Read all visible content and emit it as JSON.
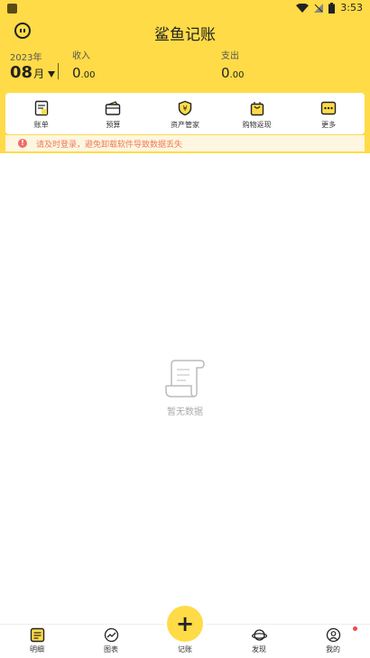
{
  "status": {
    "time": "3:53"
  },
  "header": {
    "title": "鲨鱼记账",
    "year": "2023年",
    "month": "08",
    "month_unit": "月",
    "income": {
      "label": "收入",
      "int": "0",
      "dec": ".00"
    },
    "expense": {
      "label": "支出",
      "int": "0",
      "dec": ".00"
    }
  },
  "shortcuts": [
    {
      "label": "账单",
      "icon": "bill-icon"
    },
    {
      "label": "预算",
      "icon": "wallet-icon"
    },
    {
      "label": "资产管家",
      "icon": "shield-yen-icon"
    },
    {
      "label": "购物返现",
      "icon": "shopping-bag-icon"
    },
    {
      "label": "更多",
      "icon": "more-icon"
    }
  ],
  "notice": {
    "text": "请及时登录，避免卸载软件导致数据丢失"
  },
  "empty": {
    "text": "暂无数据"
  },
  "tabs": [
    {
      "label": "明细",
      "icon": "detail-icon"
    },
    {
      "label": "图表",
      "icon": "chart-icon"
    },
    {
      "label": "记账",
      "icon": "add-icon"
    },
    {
      "label": "发现",
      "icon": "planet-icon"
    },
    {
      "label": "我的",
      "icon": "profile-icon"
    }
  ],
  "colors": {
    "accent": "#ffdb47",
    "notice_text": "#f07a5a",
    "badge": "#f04a4a"
  }
}
